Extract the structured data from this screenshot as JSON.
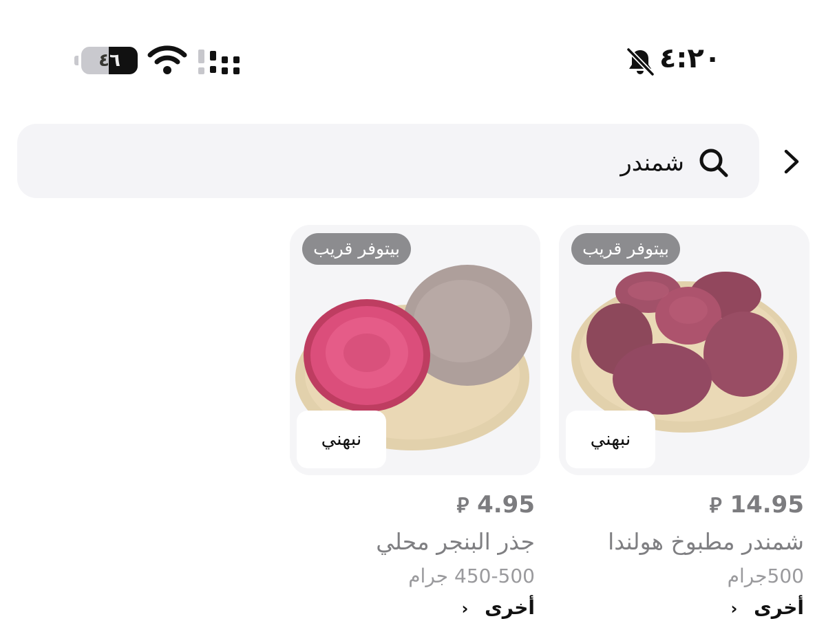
{
  "status_bar": {
    "time": "٤:٢٠",
    "battery_level": "٤٦",
    "icons": [
      "bell-muted-icon",
      "wifi-icon",
      "cellular-signal-icon",
      "battery-icon"
    ]
  },
  "search": {
    "query": "شمندر",
    "icon": "search-icon",
    "back_icon": "chevron-right-icon"
  },
  "products": [
    {
      "badge": "بيتوفر قريب",
      "brand": "نبهني",
      "price": "14.95",
      "currency": "⃁",
      "name": "شمندر مطبوخ هولندا",
      "weight": "500جرام",
      "more_label": "أخرى",
      "more_icon": "chevron-left-icon"
    },
    {
      "badge": "بيتوفر قريب",
      "brand": "نبهني",
      "price": "4.95",
      "currency": "⃁",
      "name": "جذر البنجر محلي",
      "weight": "450-500 جرام",
      "more_label": "أخرى",
      "more_icon": "chevron-left-icon"
    }
  ],
  "colors": {
    "search_bg": "#f4f4f7",
    "badge_bg": "#8c8c8f",
    "price_text": "#7c7c7f"
  }
}
